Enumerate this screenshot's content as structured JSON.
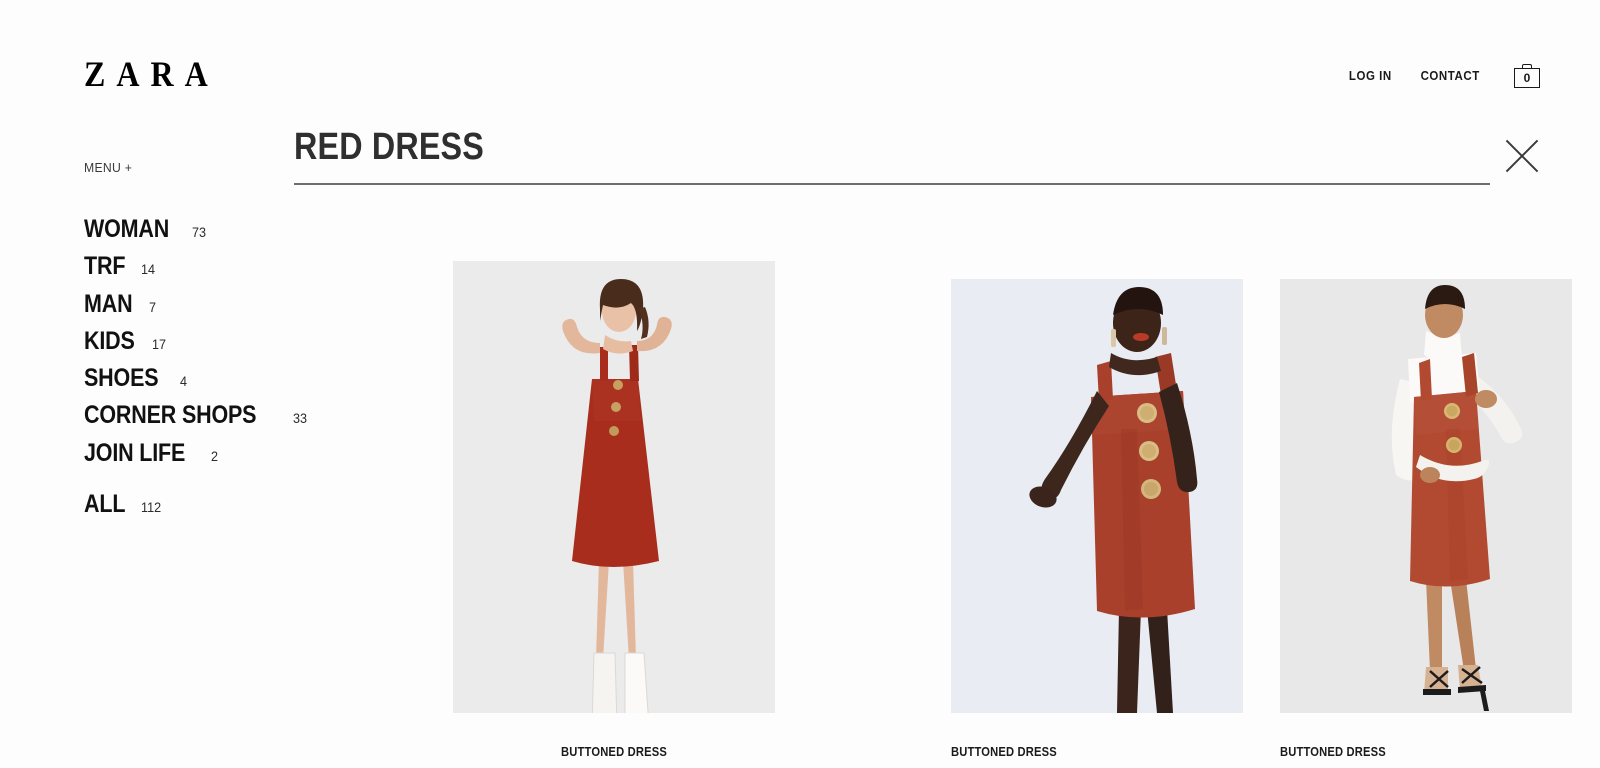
{
  "header": {
    "brand": "ZARA",
    "brand_icon": "zara-wordmark",
    "links": [
      {
        "label": "LOG IN",
        "name": "log-in"
      },
      {
        "label": "CONTACT",
        "name": "contact"
      }
    ],
    "bag": {
      "icon": "shopping-bag-icon",
      "count": "0"
    }
  },
  "sidebar": {
    "menu_toggle": "MENU +",
    "categories": [
      {
        "label": "WOMAN",
        "count": "73"
      },
      {
        "label": "TRF",
        "count": "14"
      },
      {
        "label": "MAN",
        "count": "7"
      },
      {
        "label": "KIDS",
        "count": "17"
      },
      {
        "label": "SHOES",
        "count": "4"
      },
      {
        "label": "CORNER SHOPS",
        "count": "33"
      },
      {
        "label": "JOIN LIFE",
        "count": "2"
      },
      {
        "label": "ALL",
        "count": "112"
      }
    ]
  },
  "main": {
    "title": "RED DRESS",
    "close_icon": "close-x-icon",
    "products": [
      {
        "caption": "BUTTONED DRESS",
        "background": "#ebebeb",
        "dress_color": "#a82d1d",
        "description": "model-red-buttoned-dress-white-boots"
      },
      {
        "caption": "BUTTONED DRESS",
        "background": "#e9ecf3",
        "dress_color": "#a8402b",
        "description": "model-rust-dress-gold-buttons"
      },
      {
        "caption": "BUTTONED DRESS",
        "background": "#e8e8e8",
        "dress_color": "#b24a32",
        "description": "model-rust-pinafore-white-turtleneck"
      }
    ]
  },
  "colors": {
    "page_background": "#fdfdfd",
    "text": "#1a1a1a",
    "title": "#2f2f2f",
    "rule": "#6e6e6e"
  }
}
